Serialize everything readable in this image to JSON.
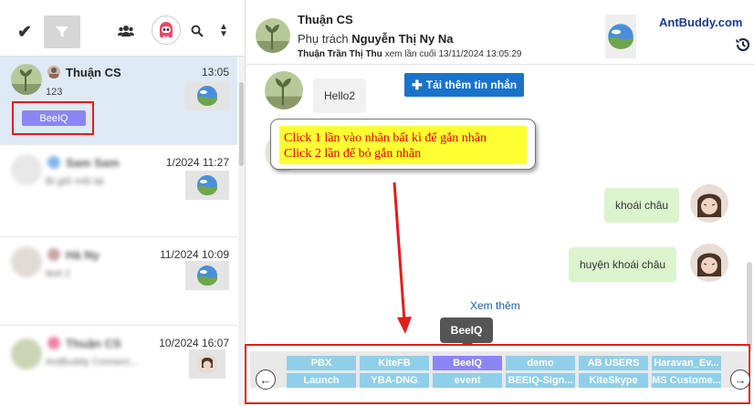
{
  "toolbar": {
    "icons": [
      "check-icon",
      "filter-icon",
      "users-icon",
      "bot-avatar",
      "search-icon",
      "sort-icon"
    ]
  },
  "conversations": [
    {
      "name": "Thuận CS",
      "time": "13:05",
      "preview": "123",
      "tag": "BeeIQ",
      "active": true
    },
    {
      "name": "Sam Sam",
      "time": "1/2024 11:27",
      "preview": "Bị giữ môi lại",
      "blurred": true
    },
    {
      "name": "Hà Ny",
      "time": "11/2024 10:09",
      "preview": "test 2",
      "blurred": true
    },
    {
      "name": "Thuận CS",
      "time": "10/2024 16:07",
      "preview": "AntBuddy Connect...",
      "blurred": true
    }
  ],
  "header": {
    "title": "Thuận CS",
    "assign_prefix": "Phụ trách",
    "assignee": "Nguyễn Thị Ny Na",
    "seen_user": "Thuận Trần Thị Thu",
    "seen_text": "xem lần cuối 13/11/2024 13:05:29",
    "brand": "AntBuddy.com"
  },
  "messages": {
    "load_more": "Tải thêm tin nhắn",
    "incoming": "Hello2",
    "outgoing": [
      "khoái châu",
      "huyện khoái châu"
    ],
    "see_more": "Xem thêm"
  },
  "callout": {
    "line1": "Click 1 lần vào nhãn bất kì để gắn nhãn",
    "line2": "Click 2 lần để bỏ gắn nhãn"
  },
  "tooltip": "BeeIQ",
  "tags": {
    "row1": [
      "PBX",
      "KiteFB",
      "BeeIQ",
      "demo",
      "AB USERS",
      "Haravan_Ev..."
    ],
    "row2": [
      "Launch",
      "YBA-DNG",
      "event",
      "BEEIQ-Sign...",
      "KiteSkype",
      "MS Custome..."
    ],
    "selected": "BeeIQ"
  },
  "colors": {
    "accent": "#1a73c9",
    "tag": "#90cfe9",
    "tag_selected": "#8b86f3",
    "highlight": "#e11d1d",
    "outgoing_bubble": "#dcf4cd"
  }
}
